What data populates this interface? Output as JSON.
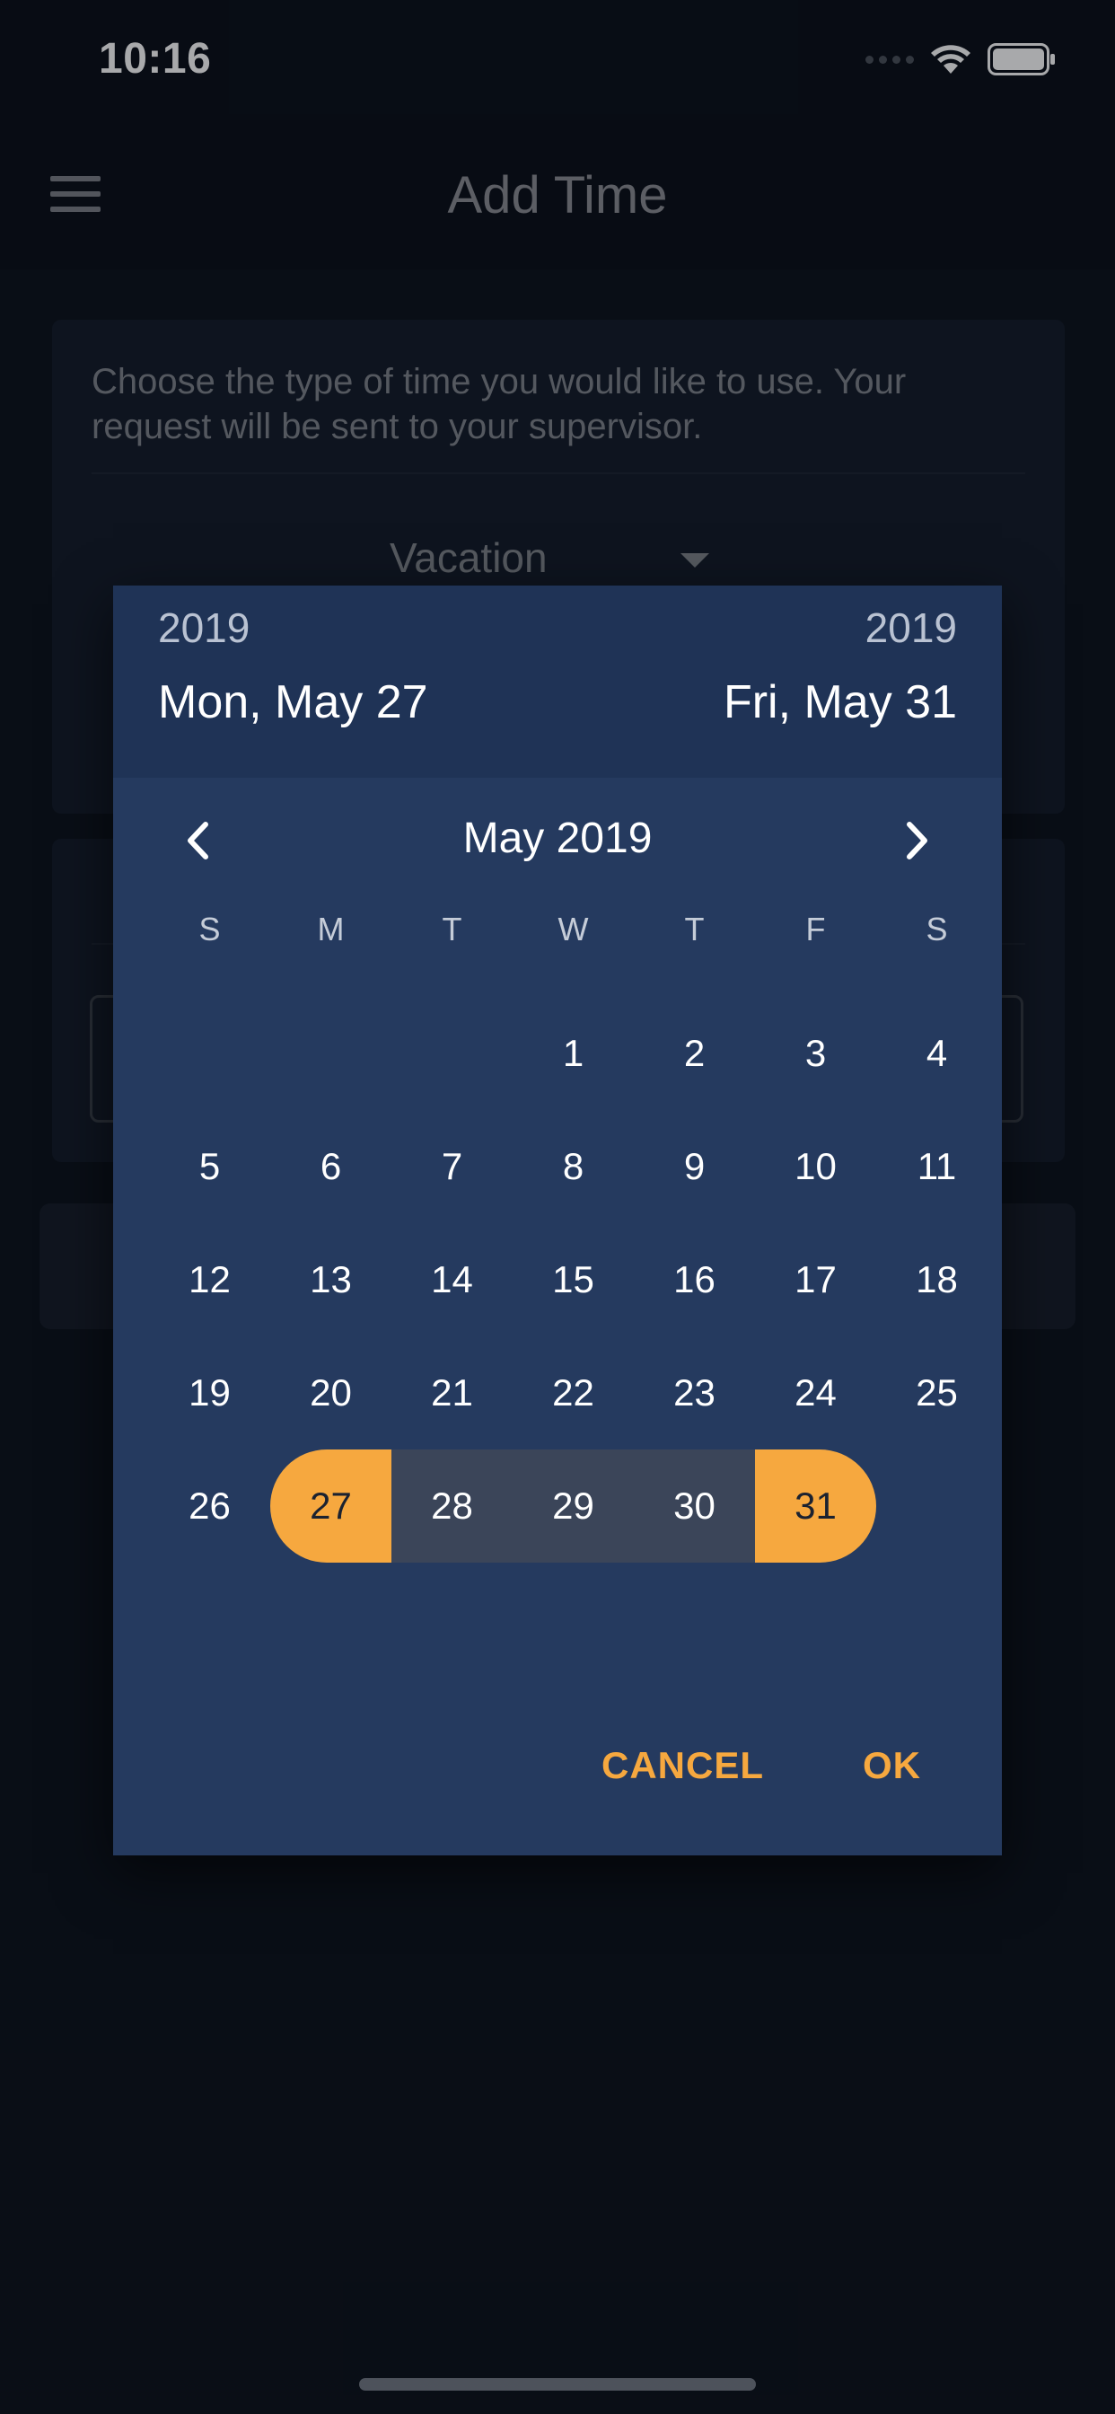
{
  "status_bar": {
    "time": "10:16"
  },
  "header": {
    "title": "Add Time"
  },
  "form": {
    "description": "Choose the type of time you would like to use. Your request will be sent to your supervisor.",
    "time_type": "Vacation"
  },
  "dialog": {
    "start": {
      "year": "2019",
      "date": "Mon, May 27"
    },
    "end": {
      "year": "2019",
      "date": "Fri, May 31"
    },
    "month_label": "May 2019",
    "weekdays": [
      "S",
      "M",
      "T",
      "W",
      "T",
      "F",
      "S"
    ],
    "weeks": [
      [
        "",
        "",
        "",
        "1",
        "2",
        "3",
        "4"
      ],
      [
        "5",
        "6",
        "7",
        "8",
        "9",
        "10",
        "11"
      ],
      [
        "12",
        "13",
        "14",
        "15",
        "16",
        "17",
        "18"
      ],
      [
        "19",
        "20",
        "21",
        "22",
        "23",
        "24",
        "25"
      ],
      [
        "26",
        "27",
        "28",
        "29",
        "30",
        "31",
        ""
      ]
    ],
    "range_start_day": "27",
    "range_end_day": "31",
    "cancel_label": "CANCEL",
    "ok_label": "OK"
  },
  "colors": {
    "accent": "#f6a83f",
    "dialog_bg": "#253a5f",
    "dialog_header_bg": "#1f3356",
    "range_bg": "#3b4559"
  }
}
